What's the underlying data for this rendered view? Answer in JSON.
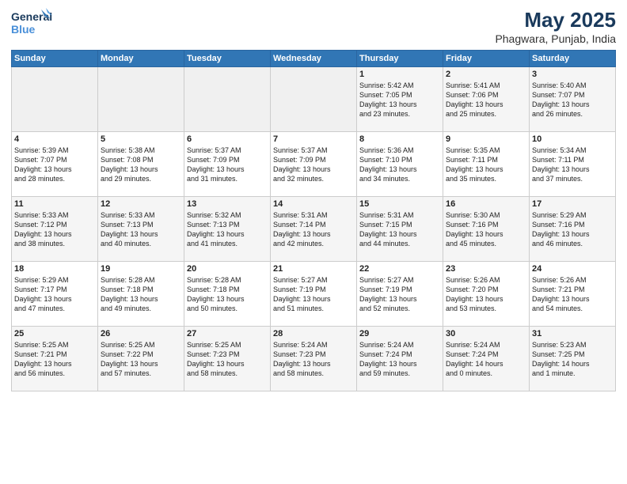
{
  "header": {
    "logo_line1": "General",
    "logo_line2": "Blue",
    "month_year": "May 2025",
    "location": "Phagwara, Punjab, India"
  },
  "weekdays": [
    "Sunday",
    "Monday",
    "Tuesday",
    "Wednesday",
    "Thursday",
    "Friday",
    "Saturday"
  ],
  "weeks": [
    [
      {
        "day": "",
        "info": ""
      },
      {
        "day": "",
        "info": ""
      },
      {
        "day": "",
        "info": ""
      },
      {
        "day": "",
        "info": ""
      },
      {
        "day": "1",
        "info": "Sunrise: 5:42 AM\nSunset: 7:05 PM\nDaylight: 13 hours\nand 23 minutes."
      },
      {
        "day": "2",
        "info": "Sunrise: 5:41 AM\nSunset: 7:06 PM\nDaylight: 13 hours\nand 25 minutes."
      },
      {
        "day": "3",
        "info": "Sunrise: 5:40 AM\nSunset: 7:07 PM\nDaylight: 13 hours\nand 26 minutes."
      }
    ],
    [
      {
        "day": "4",
        "info": "Sunrise: 5:39 AM\nSunset: 7:07 PM\nDaylight: 13 hours\nand 28 minutes."
      },
      {
        "day": "5",
        "info": "Sunrise: 5:38 AM\nSunset: 7:08 PM\nDaylight: 13 hours\nand 29 minutes."
      },
      {
        "day": "6",
        "info": "Sunrise: 5:37 AM\nSunset: 7:09 PM\nDaylight: 13 hours\nand 31 minutes."
      },
      {
        "day": "7",
        "info": "Sunrise: 5:37 AM\nSunset: 7:09 PM\nDaylight: 13 hours\nand 32 minutes."
      },
      {
        "day": "8",
        "info": "Sunrise: 5:36 AM\nSunset: 7:10 PM\nDaylight: 13 hours\nand 34 minutes."
      },
      {
        "day": "9",
        "info": "Sunrise: 5:35 AM\nSunset: 7:11 PM\nDaylight: 13 hours\nand 35 minutes."
      },
      {
        "day": "10",
        "info": "Sunrise: 5:34 AM\nSunset: 7:11 PM\nDaylight: 13 hours\nand 37 minutes."
      }
    ],
    [
      {
        "day": "11",
        "info": "Sunrise: 5:33 AM\nSunset: 7:12 PM\nDaylight: 13 hours\nand 38 minutes."
      },
      {
        "day": "12",
        "info": "Sunrise: 5:33 AM\nSunset: 7:13 PM\nDaylight: 13 hours\nand 40 minutes."
      },
      {
        "day": "13",
        "info": "Sunrise: 5:32 AM\nSunset: 7:13 PM\nDaylight: 13 hours\nand 41 minutes."
      },
      {
        "day": "14",
        "info": "Sunrise: 5:31 AM\nSunset: 7:14 PM\nDaylight: 13 hours\nand 42 minutes."
      },
      {
        "day": "15",
        "info": "Sunrise: 5:31 AM\nSunset: 7:15 PM\nDaylight: 13 hours\nand 44 minutes."
      },
      {
        "day": "16",
        "info": "Sunrise: 5:30 AM\nSunset: 7:16 PM\nDaylight: 13 hours\nand 45 minutes."
      },
      {
        "day": "17",
        "info": "Sunrise: 5:29 AM\nSunset: 7:16 PM\nDaylight: 13 hours\nand 46 minutes."
      }
    ],
    [
      {
        "day": "18",
        "info": "Sunrise: 5:29 AM\nSunset: 7:17 PM\nDaylight: 13 hours\nand 47 minutes."
      },
      {
        "day": "19",
        "info": "Sunrise: 5:28 AM\nSunset: 7:18 PM\nDaylight: 13 hours\nand 49 minutes."
      },
      {
        "day": "20",
        "info": "Sunrise: 5:28 AM\nSunset: 7:18 PM\nDaylight: 13 hours\nand 50 minutes."
      },
      {
        "day": "21",
        "info": "Sunrise: 5:27 AM\nSunset: 7:19 PM\nDaylight: 13 hours\nand 51 minutes."
      },
      {
        "day": "22",
        "info": "Sunrise: 5:27 AM\nSunset: 7:19 PM\nDaylight: 13 hours\nand 52 minutes."
      },
      {
        "day": "23",
        "info": "Sunrise: 5:26 AM\nSunset: 7:20 PM\nDaylight: 13 hours\nand 53 minutes."
      },
      {
        "day": "24",
        "info": "Sunrise: 5:26 AM\nSunset: 7:21 PM\nDaylight: 13 hours\nand 54 minutes."
      }
    ],
    [
      {
        "day": "25",
        "info": "Sunrise: 5:25 AM\nSunset: 7:21 PM\nDaylight: 13 hours\nand 56 minutes."
      },
      {
        "day": "26",
        "info": "Sunrise: 5:25 AM\nSunset: 7:22 PM\nDaylight: 13 hours\nand 57 minutes."
      },
      {
        "day": "27",
        "info": "Sunrise: 5:25 AM\nSunset: 7:23 PM\nDaylight: 13 hours\nand 58 minutes."
      },
      {
        "day": "28",
        "info": "Sunrise: 5:24 AM\nSunset: 7:23 PM\nDaylight: 13 hours\nand 58 minutes."
      },
      {
        "day": "29",
        "info": "Sunrise: 5:24 AM\nSunset: 7:24 PM\nDaylight: 13 hours\nand 59 minutes."
      },
      {
        "day": "30",
        "info": "Sunrise: 5:24 AM\nSunset: 7:24 PM\nDaylight: 14 hours\nand 0 minutes."
      },
      {
        "day": "31",
        "info": "Sunrise: 5:23 AM\nSunset: 7:25 PM\nDaylight: 14 hours\nand 1 minute."
      }
    ]
  ]
}
